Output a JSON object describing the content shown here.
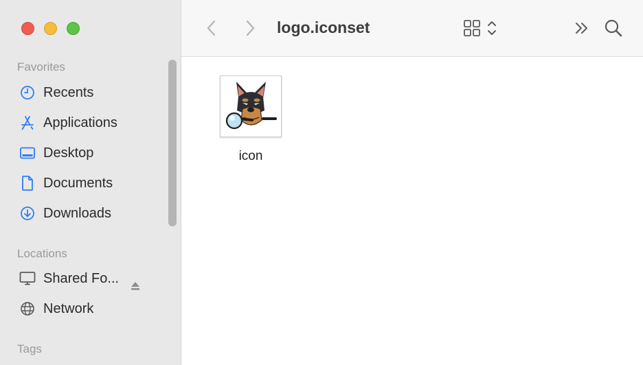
{
  "window": {
    "title": "logo.iconset"
  },
  "sidebar": {
    "favorites_title": "Favorites",
    "favorites": [
      {
        "label": "Recents",
        "icon": "clock-icon"
      },
      {
        "label": "Applications",
        "icon": "applications-icon"
      },
      {
        "label": "Desktop",
        "icon": "desktop-icon"
      },
      {
        "label": "Documents",
        "icon": "document-icon"
      },
      {
        "label": "Downloads",
        "icon": "download-icon"
      }
    ],
    "locations_title": "Locations",
    "locations": [
      {
        "label": "Shared Fo...",
        "icon": "display-icon"
      },
      {
        "label": "Network",
        "icon": "globe-icon"
      }
    ],
    "tags_title": "Tags"
  },
  "files": [
    {
      "name": "icon",
      "thumbnail": "doberman-magnifier-logo"
    }
  ],
  "colors": {
    "accent": "#2f7cf6",
    "sidebar_bg": "#e8e8e8",
    "close": "#ee5c55",
    "minimize": "#f5bd3a",
    "maximize": "#5ec24b"
  }
}
